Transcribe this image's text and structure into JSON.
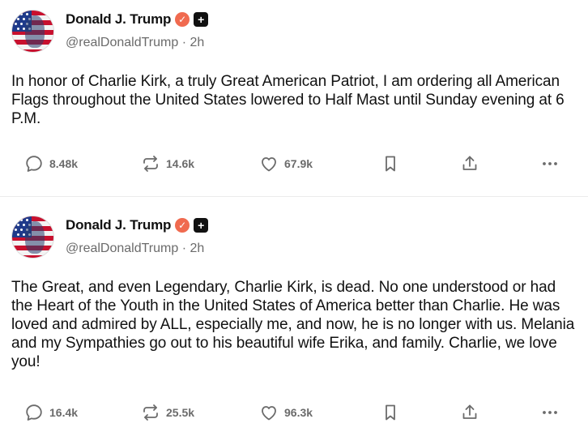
{
  "posts": [
    {
      "author": {
        "name": "Donald J. Trump",
        "verified_glyph": "✓",
        "plus_glyph": "+",
        "handle": "@realDonaldTrump",
        "separator": "·",
        "time": "2h"
      },
      "text": "In honor of Charlie Kirk, a truly Great American Patriot, I am ordering all American Flags throughout the United States lowered to Half Mast until Sunday evening at 6 P.M.",
      "stats": {
        "replies": "8.48k",
        "retruths": "14.6k",
        "likes": "67.9k"
      }
    },
    {
      "author": {
        "name": "Donald J. Trump",
        "verified_glyph": "✓",
        "plus_glyph": "+",
        "handle": "@realDonaldTrump",
        "separator": "·",
        "time": "2h"
      },
      "text": "The Great, and even Legendary, Charlie Kirk, is dead. No one understood or had the Heart of the Youth in the United States of America better than Charlie. He was loved and admired by ALL, especially me, and now, he is no longer with us. Melania and my Sympathies go out to his beautiful wife Erika, and family. Charlie, we love you!",
      "stats": {
        "replies": "16.4k",
        "retruths": "25.5k",
        "likes": "96.3k"
      }
    }
  ],
  "icons": {
    "reply": "speech-bubble-icon",
    "retruth": "repost-arrows-icon",
    "like": "heart-icon",
    "save": "bookmark-icon",
    "share": "share-upload-icon",
    "more": "more-dots-icon"
  },
  "colors": {
    "verified_badge": "#f06a4f",
    "icon_gray": "#6b6b6b",
    "text": "#111111",
    "divider": "#ececec"
  }
}
